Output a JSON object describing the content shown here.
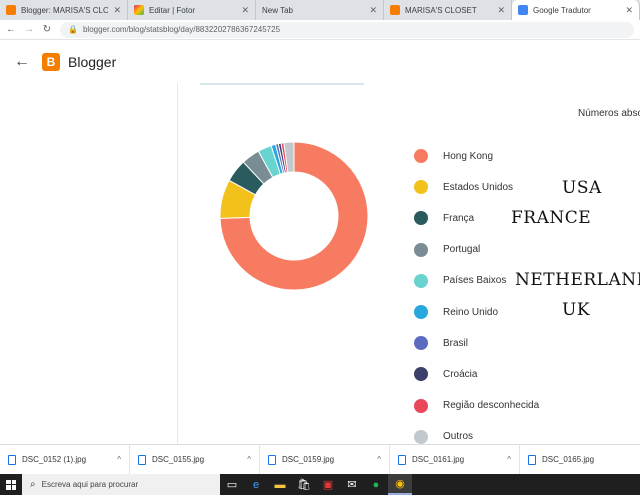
{
  "tabs": [
    {
      "title": "Blogger: MARISA'S CLOSET",
      "color": "#f57d00",
      "active": false
    },
    {
      "title": "Editar | Fotor",
      "color": "#e91e63",
      "active": false
    },
    {
      "title": "New Tab",
      "color": "",
      "active": false
    },
    {
      "title": "MARISA'S CLOSET",
      "color": "#f57d00",
      "active": false
    },
    {
      "title": "Google Tradutor",
      "color": "#4285f4",
      "active": false
    }
  ],
  "address": {
    "url": "blogger.com/blog/statsblog/day/883220278636724572​5"
  },
  "header": {
    "back_icon": "arrow-left-icon",
    "logo_letter": "B",
    "app_name": "Blogger"
  },
  "main": {
    "numeros_label": "Números abso"
  },
  "chart_data": {
    "type": "pie",
    "donut": true,
    "categories": [
      "Hong Kong",
      "Estados Unidos",
      "França",
      "Portugal",
      "Países Baixos",
      "Reino Unido",
      "Brasil",
      "Croácia",
      "Região desconhecida",
      "Outros"
    ],
    "values": [
      74.5,
      8.5,
      5,
      4,
      3,
      1,
      0.6,
      0.6,
      0.6,
      2.2
    ],
    "colors": [
      "#f77b60",
      "#f2c21a",
      "#2a5b5e",
      "#7b8d94",
      "#68d3cf",
      "#29a8e0",
      "#5c6bc0",
      "#3d3f6b",
      "#e8475c",
      "#c2c8cc"
    ]
  },
  "annotations": [
    {
      "text": "USA"
    },
    {
      "text": "FRANCE"
    },
    {
      "text": "NETHERLANDS"
    },
    {
      "text": "UK"
    }
  ],
  "downloads": [
    {
      "file": "DSC_0152 (1).jpg"
    },
    {
      "file": "DSC_0155.jpg"
    },
    {
      "file": "DSC_0159.jpg"
    },
    {
      "file": "DSC_0161.jpg"
    },
    {
      "file": "DSC_0165.jpg"
    }
  ],
  "taskbar": {
    "search_placeholder": "Escreva aqui para procurar"
  }
}
